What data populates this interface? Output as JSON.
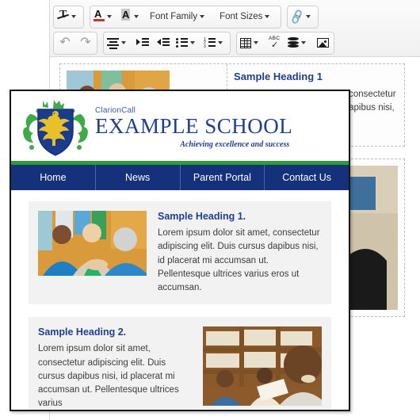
{
  "editor": {
    "toolbar": {
      "row1": [
        {
          "name": "clear-formatting",
          "icon": "clear-formatting-icon",
          "label": "",
          "caret": true,
          "disabled": false
        },
        {
          "name": "text-color",
          "icon": "font-color-icon",
          "label": "",
          "caret": true,
          "disabled": false
        },
        {
          "name": "background-color",
          "icon": "highlight-color-icon",
          "label": "",
          "caret": true,
          "disabled": false
        },
        {
          "name": "font-family",
          "icon": "",
          "label": "Font Family",
          "caret": true,
          "disabled": false
        },
        {
          "name": "font-sizes",
          "icon": "",
          "label": "Font Sizes",
          "caret": true,
          "disabled": false
        },
        {
          "name": "insert-link",
          "icon": "link-icon",
          "label": "",
          "caret": true,
          "disabled": false
        }
      ],
      "row2": [
        {
          "name": "undo",
          "icon": "undo-icon",
          "label": "",
          "caret": false,
          "disabled": true
        },
        {
          "name": "redo",
          "icon": "redo-icon",
          "label": "",
          "caret": false,
          "disabled": true
        },
        {
          "name": "align",
          "icon": "align-center-icon",
          "label": "",
          "caret": true,
          "disabled": false
        },
        {
          "name": "indent",
          "icon": "indent-increase-icon",
          "label": "",
          "caret": false,
          "disabled": false
        },
        {
          "name": "outdent",
          "icon": "indent-decrease-icon",
          "label": "",
          "caret": false,
          "disabled": false
        },
        {
          "name": "bullet-list",
          "icon": "unordered-list-icon",
          "label": "",
          "caret": true,
          "disabled": false
        },
        {
          "name": "numbered-list",
          "icon": "ordered-list-icon",
          "label": "",
          "caret": true,
          "disabled": false
        },
        {
          "name": "table",
          "icon": "table-icon",
          "label": "",
          "caret": true,
          "disabled": false
        },
        {
          "name": "spellcheck",
          "icon": "spellcheck-icon",
          "label": "",
          "caret": false,
          "disabled": false
        },
        {
          "name": "database",
          "icon": "database-icon",
          "label": "",
          "caret": true,
          "disabled": false
        },
        {
          "name": "insert-image",
          "icon": "image-icon",
          "label": "",
          "caret": false,
          "disabled": false
        }
      ]
    },
    "canvas": {
      "cell_a": {
        "image_alt": "people-smiling-photo",
        "heading": "Sample Heading 1",
        "body": "Lorem ipsum dolor sit amet, consectetur adipiscing elit. Duis cursus dapibus nisi, id placerat mi accumsan ut. Pellentesque"
      },
      "cell_b": {
        "image_alt": "students-classroom-photo"
      }
    }
  },
  "dialog": {
    "header": {
      "crest_alt": "school-crest-shield-eagle",
      "sub_name": "ClarionCall",
      "school_name": "EXAMPLE SCHOOL",
      "tagline": "Achieving excellence and success"
    },
    "nav": [
      {
        "label": "Home"
      },
      {
        "label": "News"
      },
      {
        "label": "Parent Portal"
      },
      {
        "label": "Contact Us"
      }
    ],
    "blocks": [
      {
        "heading": "Sample Heading 1.",
        "body": "Lorem ipsum dolor sit amet, consectetur adipiscing elit. Duis cursus dapibus nisi, id placerat mi accumsan ut. Pellentesque ultrices varius eros ut accumsan.",
        "image_alt": "parents-handshake-photo",
        "image_position": "left"
      },
      {
        "heading": "Sample Heading 2.",
        "body": "Lorem ipsum dolor sit amet, consectetur adipiscing elit. Duis cursus dapibus nisi, id placerat mi accumsan ut. Pellentesque ultrices varius",
        "image_alt": "children-library-reading-photo",
        "image_position": "right"
      }
    ]
  },
  "colors": {
    "nav_blue": "#16317c",
    "accent_green": "#2f9b3d",
    "heading_blue": "#1f3f8f",
    "crest_gold": "#e8c12a",
    "block_bg": "#f2f2f2"
  }
}
